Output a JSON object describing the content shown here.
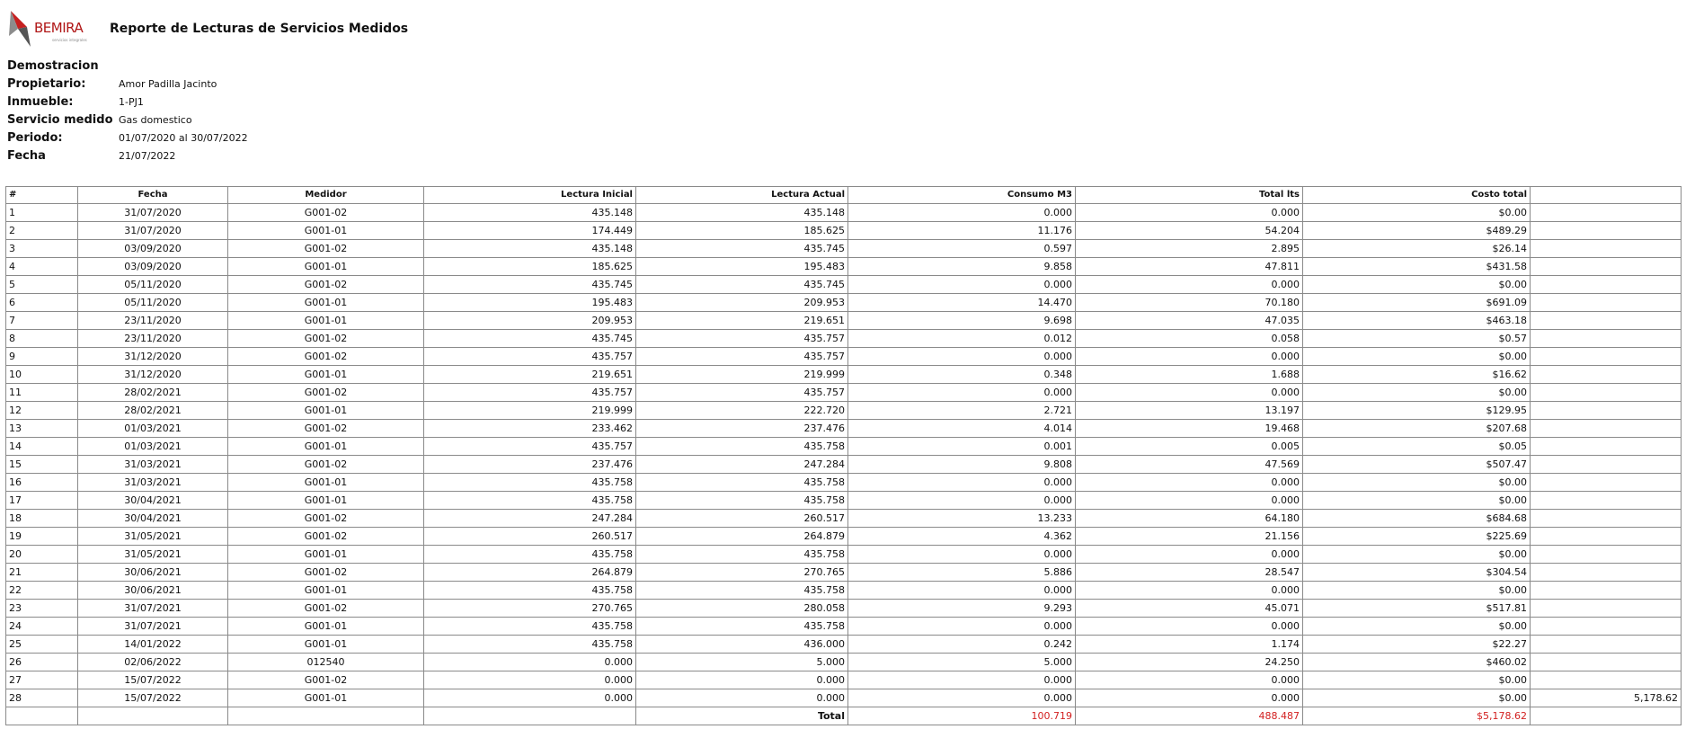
{
  "header": {
    "logo_text": "BEMIRA",
    "logo_subtext": "servicios integrales",
    "title": "Reporte de Lecturas de Servicios Medidos"
  },
  "info": {
    "company": "Demostracion",
    "rows": [
      {
        "label": "Propietario:",
        "value": "Amor Padilla Jacinto"
      },
      {
        "label": "Inmueble:",
        "value": "1-PJ1"
      },
      {
        "label": "Servicio medido",
        "value": "Gas domestico"
      },
      {
        "label": "Periodo:",
        "value": "01/07/2020 al 30/07/2022"
      },
      {
        "label": "Fecha",
        "value": "21/07/2022"
      }
    ]
  },
  "table": {
    "headers": [
      "#",
      "Fecha",
      "Medidor",
      "Lectura Inicial",
      "Lectura Actual",
      "Consumo M3",
      "Total lts",
      "Costo total",
      ""
    ],
    "rows": [
      [
        "1",
        "31/07/2020",
        "G001-02",
        "435.148",
        "435.148",
        "0.000",
        "0.000",
        "$0.00",
        ""
      ],
      [
        "2",
        "31/07/2020",
        "G001-01",
        "174.449",
        "185.625",
        "11.176",
        "54.204",
        "$489.29",
        ""
      ],
      [
        "3",
        "03/09/2020",
        "G001-02",
        "435.148",
        "435.745",
        "0.597",
        "2.895",
        "$26.14",
        ""
      ],
      [
        "4",
        "03/09/2020",
        "G001-01",
        "185.625",
        "195.483",
        "9.858",
        "47.811",
        "$431.58",
        ""
      ],
      [
        "5",
        "05/11/2020",
        "G001-02",
        "435.745",
        "435.745",
        "0.000",
        "0.000",
        "$0.00",
        ""
      ],
      [
        "6",
        "05/11/2020",
        "G001-01",
        "195.483",
        "209.953",
        "14.470",
        "70.180",
        "$691.09",
        ""
      ],
      [
        "7",
        "23/11/2020",
        "G001-01",
        "209.953",
        "219.651",
        "9.698",
        "47.035",
        "$463.18",
        ""
      ],
      [
        "8",
        "23/11/2020",
        "G001-02",
        "435.745",
        "435.757",
        "0.012",
        "0.058",
        "$0.57",
        ""
      ],
      [
        "9",
        "31/12/2020",
        "G001-02",
        "435.757",
        "435.757",
        "0.000",
        "0.000",
        "$0.00",
        ""
      ],
      [
        "10",
        "31/12/2020",
        "G001-01",
        "219.651",
        "219.999",
        "0.348",
        "1.688",
        "$16.62",
        ""
      ],
      [
        "11",
        "28/02/2021",
        "G001-02",
        "435.757",
        "435.757",
        "0.000",
        "0.000",
        "$0.00",
        ""
      ],
      [
        "12",
        "28/02/2021",
        "G001-01",
        "219.999",
        "222.720",
        "2.721",
        "13.197",
        "$129.95",
        ""
      ],
      [
        "13",
        "01/03/2021",
        "G001-02",
        "233.462",
        "237.476",
        "4.014",
        "19.468",
        "$207.68",
        ""
      ],
      [
        "14",
        "01/03/2021",
        "G001-01",
        "435.757",
        "435.758",
        "0.001",
        "0.005",
        "$0.05",
        ""
      ],
      [
        "15",
        "31/03/2021",
        "G001-02",
        "237.476",
        "247.284",
        "9.808",
        "47.569",
        "$507.47",
        ""
      ],
      [
        "16",
        "31/03/2021",
        "G001-01",
        "435.758",
        "435.758",
        "0.000",
        "0.000",
        "$0.00",
        ""
      ],
      [
        "17",
        "30/04/2021",
        "G001-01",
        "435.758",
        "435.758",
        "0.000",
        "0.000",
        "$0.00",
        ""
      ],
      [
        "18",
        "30/04/2021",
        "G001-02",
        "247.284",
        "260.517",
        "13.233",
        "64.180",
        "$684.68",
        ""
      ],
      [
        "19",
        "31/05/2021",
        "G001-02",
        "260.517",
        "264.879",
        "4.362",
        "21.156",
        "$225.69",
        ""
      ],
      [
        "20",
        "31/05/2021",
        "G001-01",
        "435.758",
        "435.758",
        "0.000",
        "0.000",
        "$0.00",
        ""
      ],
      [
        "21",
        "30/06/2021",
        "G001-02",
        "264.879",
        "270.765",
        "5.886",
        "28.547",
        "$304.54",
        ""
      ],
      [
        "22",
        "30/06/2021",
        "G001-01",
        "435.758",
        "435.758",
        "0.000",
        "0.000",
        "$0.00",
        ""
      ],
      [
        "23",
        "31/07/2021",
        "G001-02",
        "270.765",
        "280.058",
        "9.293",
        "45.071",
        "$517.81",
        ""
      ],
      [
        "24",
        "31/07/2021",
        "G001-01",
        "435.758",
        "435.758",
        "0.000",
        "0.000",
        "$0.00",
        ""
      ],
      [
        "25",
        "14/01/2022",
        "G001-01",
        "435.758",
        "436.000",
        "0.242",
        "1.174",
        "$22.27",
        ""
      ],
      [
        "26",
        "02/06/2022",
        "012540",
        "0.000",
        "5.000",
        "5.000",
        "24.250",
        "$460.02",
        ""
      ],
      [
        "27",
        "15/07/2022",
        "G001-02",
        "0.000",
        "0.000",
        "0.000",
        "0.000",
        "$0.00",
        ""
      ],
      [
        "28",
        "15/07/2022",
        "G001-01",
        "0.000",
        "0.000",
        "0.000",
        "0.000",
        "$0.00",
        "5,178.62"
      ]
    ],
    "total": {
      "label": "Total",
      "consumo": "100.719",
      "litros": "488.487",
      "costo": "$5,178.62"
    }
  },
  "colors": {
    "accent_red": "#d21f1f",
    "border": "#8a8a8a"
  }
}
